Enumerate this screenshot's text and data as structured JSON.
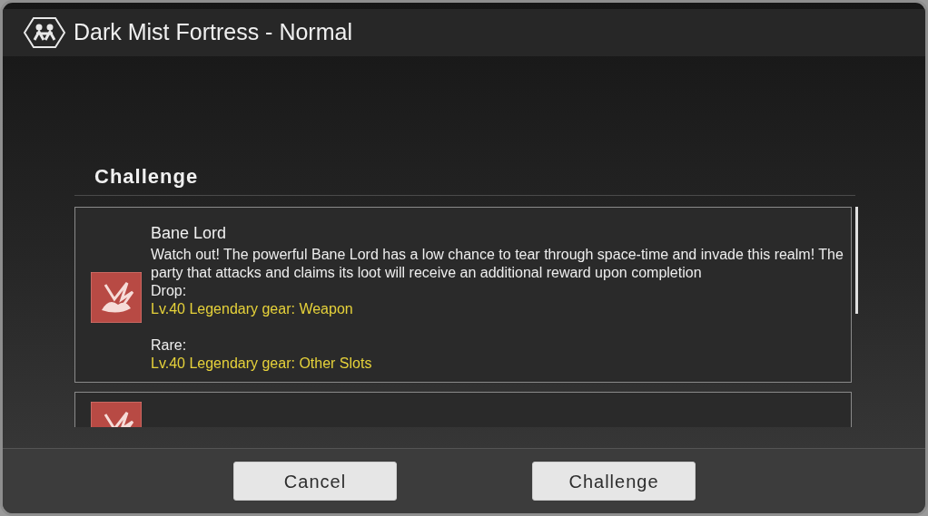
{
  "window": {
    "title": "Dark Mist Fortress - Normal"
  },
  "section_title": "Challenge",
  "challenges": [
    {
      "kind": "full",
      "name": "Bane Lord",
      "description": "Watch out! The powerful Bane Lord has a low chance to tear through space-time and invade this realm! The party that attacks and claims its loot will receive an additional reward upon completion",
      "drop_label": "Drop:",
      "drop_item": "Lv.40 Legendary gear: Weapon",
      "rare_label": "Rare:",
      "rare_item": "Lv.40 Legendary gear: Other Slots"
    },
    {
      "kind": "partial"
    }
  ],
  "buttons": [
    "Cancel",
    "Challenge"
  ]
}
